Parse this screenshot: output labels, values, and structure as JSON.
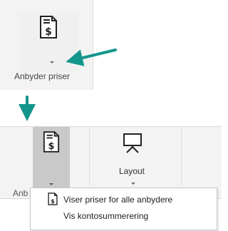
{
  "top_button": {
    "label": "Anbyder priser",
    "icon": "price-document-icon"
  },
  "bottom_ribbon": {
    "selected_button": {
      "partial_label": "Anb",
      "icon": "price-document-icon"
    },
    "layout_button": {
      "label": "Layout",
      "icon": "presentation-easel-icon"
    }
  },
  "dropdown_menu": {
    "items": [
      {
        "label": "Viser priser for alle anbydere",
        "icon": "price-document-icon"
      },
      {
        "label": "Vis kontosummerering"
      }
    ]
  },
  "colors": {
    "arrow": "#14968c",
    "selected_bg": "#c9c9c9",
    "ribbon_bg": "#f3f3f3"
  }
}
